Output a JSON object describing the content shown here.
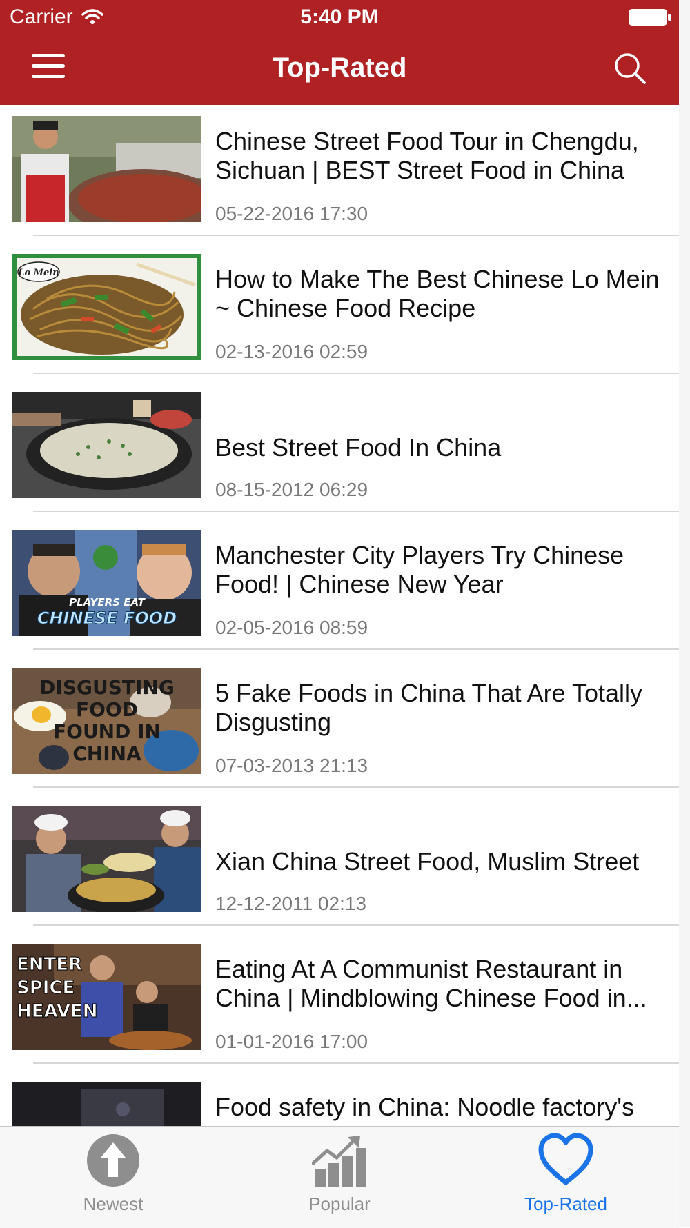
{
  "status_bar": {
    "carrier": "Carrier",
    "time": "5:40 PM"
  },
  "nav": {
    "title": "Top-Rated"
  },
  "videos": [
    {
      "title": "Chinese Street Food Tour in Chengdu, Sichuan | BEST Street Food in China",
      "date": "05-22-2016 17:30"
    },
    {
      "title": "How to Make The Best Chinese Lo Mein ~ Chinese Food Recipe",
      "date": "02-13-2016 02:59",
      "thumb_text": "Lo Mein"
    },
    {
      "title": "Best Street Food In China",
      "date": "08-15-2012 06:29"
    },
    {
      "title": "Manchester City Players Try Chinese Food! | Chinese New Year",
      "date": "02-05-2016 08:59",
      "thumb_text_top": "PLAYERS EAT",
      "thumb_text_bottom": "CHINESE FOOD"
    },
    {
      "title": "5 Fake Foods in China That Are Totally Disgusting",
      "date": "07-03-2013 21:13",
      "thumb_lines": [
        "DISGUSTING",
        "FOOD",
        "FOUND IN",
        "CHINA"
      ]
    },
    {
      "title": "Xian China Street Food, Muslim Street",
      "date": "12-12-2011 02:13"
    },
    {
      "title": "Eating At A Communist Restaurant in China | Mindblowing Chinese Food in...",
      "date": "01-01-2016 17:00",
      "thumb_lines": [
        "ENTER",
        "SPICE",
        "HEAVEN"
      ]
    },
    {
      "title": "Food safety in China: Noodle factory's",
      "date": ""
    }
  ],
  "tabs": [
    {
      "label": "Newest",
      "icon": "up-arrow-circle-icon"
    },
    {
      "label": "Popular",
      "icon": "trending-chart-icon"
    },
    {
      "label": "Top-Rated",
      "icon": "heart-icon"
    }
  ],
  "colors": {
    "brand": "#b02124",
    "active_tab": "#1b73e8",
    "inactive_tab": "#8e8e8e"
  }
}
